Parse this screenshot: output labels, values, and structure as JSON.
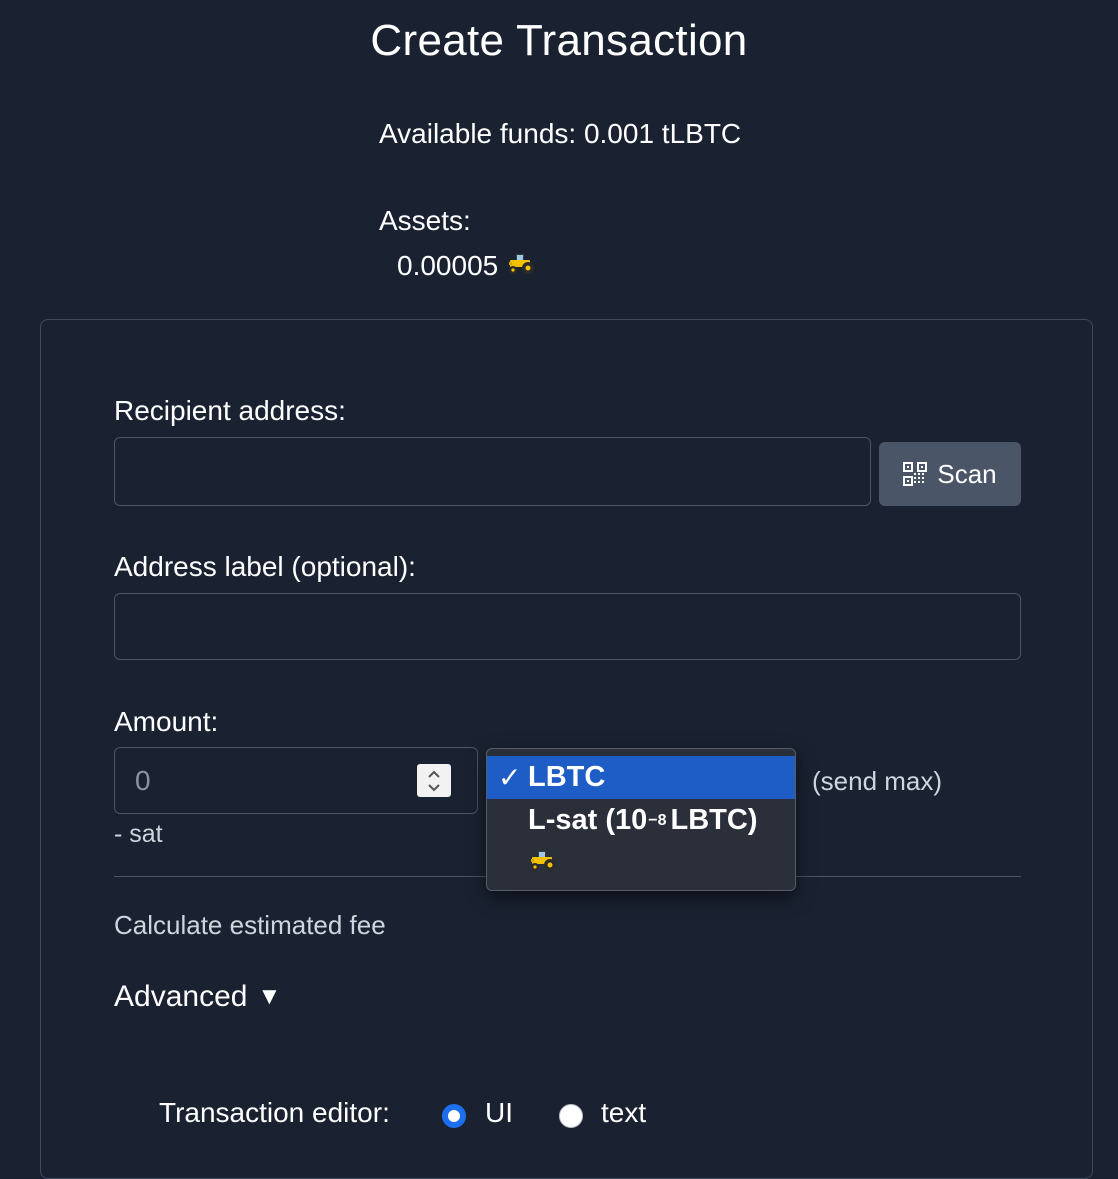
{
  "page": {
    "title": "Create Transaction",
    "available_funds": "Available funds: 0.001 tLBTC",
    "assets_label": "Assets:",
    "assets": [
      {
        "amount": "0.00005",
        "icon": "tractor-icon"
      }
    ]
  },
  "form": {
    "recipient_label": "Recipient address:",
    "recipient_value": "",
    "scan_button": "Scan",
    "address_label_label": "Address label (optional):",
    "address_label_value": "",
    "amount_label": "Amount:",
    "amount_placeholder": "0",
    "sat_text": "- sat",
    "send_max": "(send max)",
    "calculate_fee": "Calculate estimated fee",
    "advanced": "Advanced",
    "advanced_arrow": "▼",
    "tx_editor_label": "Transaction editor:",
    "tx_editor_options": [
      {
        "label": "UI",
        "checked": true
      },
      {
        "label": "text",
        "checked": false
      }
    ]
  },
  "unit_dropdown": {
    "options": [
      {
        "label": "LBTC",
        "selected": true
      },
      {
        "label_prefix": "L-sat (10",
        "label_exp": "−8",
        "label_suffix": "LBTC)",
        "selected": false
      },
      {
        "icon": "tractor-icon",
        "selected": false
      }
    ],
    "check_mark": "✓"
  },
  "colors": {
    "background": "#1a2231",
    "accent": "#1e6ff0",
    "selection": "#1e5cc6",
    "button_bg": "#4a5668"
  }
}
